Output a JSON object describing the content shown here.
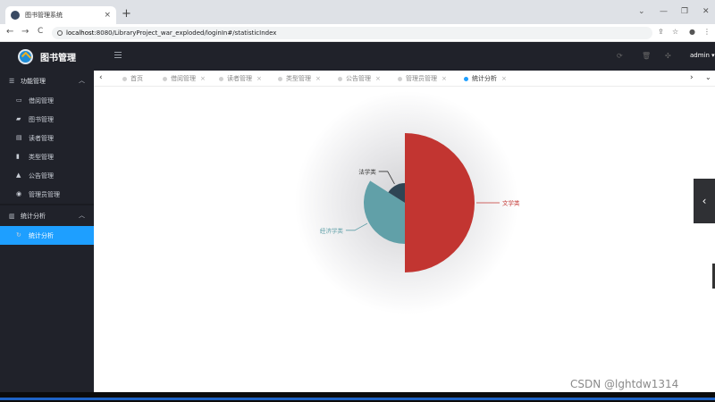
{
  "browser": {
    "tab_title": "图书管理系统",
    "tab_close": "×",
    "new_tab": "+",
    "url_host": "localhost",
    "url_rest": ":8080/LibraryProject_war_exploded/loginIn#/statisticIndex",
    "nav": {
      "back": "←",
      "forward": "→",
      "reload": "C"
    },
    "window": {
      "collapse": "⌄",
      "minimize": "—",
      "restore": "❐",
      "close": "✕"
    }
  },
  "header": {
    "brand": "图书管理",
    "user": "admin ▾",
    "icons": [
      "refresh-icon",
      "trash-icon",
      "fullscreen-icon"
    ]
  },
  "sidebar": {
    "groups": [
      {
        "label": "功能管理",
        "icon": "list-icon",
        "items": [
          {
            "label": "借阅管理",
            "icon": "calendar-icon"
          },
          {
            "label": "图书管理",
            "icon": "book-icon"
          },
          {
            "label": "读者管理",
            "icon": "card-icon"
          },
          {
            "label": "类型管理",
            "icon": "file-icon"
          },
          {
            "label": "公告管理",
            "icon": "bell-icon"
          },
          {
            "label": "管理员管理",
            "icon": "user-circle-icon"
          }
        ]
      },
      {
        "label": "统计分析",
        "icon": "bar-chart-icon",
        "items": [
          {
            "label": "统计分析",
            "icon": "refresh-icon",
            "active": true
          }
        ]
      }
    ]
  },
  "page_tabs": [
    {
      "label": "首页"
    },
    {
      "label": "借阅管理"
    },
    {
      "label": "读者管理"
    },
    {
      "label": "类型管理"
    },
    {
      "label": "公告管理"
    },
    {
      "label": "管理员管理"
    },
    {
      "label": "统计分析",
      "current": true
    }
  ],
  "chart_data": {
    "type": "pie",
    "variant": "nightingale-rose",
    "series": [
      {
        "name": "文学类",
        "value": 50,
        "color": "#c23531"
      },
      {
        "name": "经济学类",
        "value": 34,
        "color": "#61a0a8"
      },
      {
        "name": "法学类",
        "value": 16,
        "color": "#2f4554"
      }
    ],
    "legend": "none",
    "labels": "outside-with-leader-lines"
  },
  "drawer_arrow": "‹",
  "watermark": "CSDN @lghtdw1314"
}
